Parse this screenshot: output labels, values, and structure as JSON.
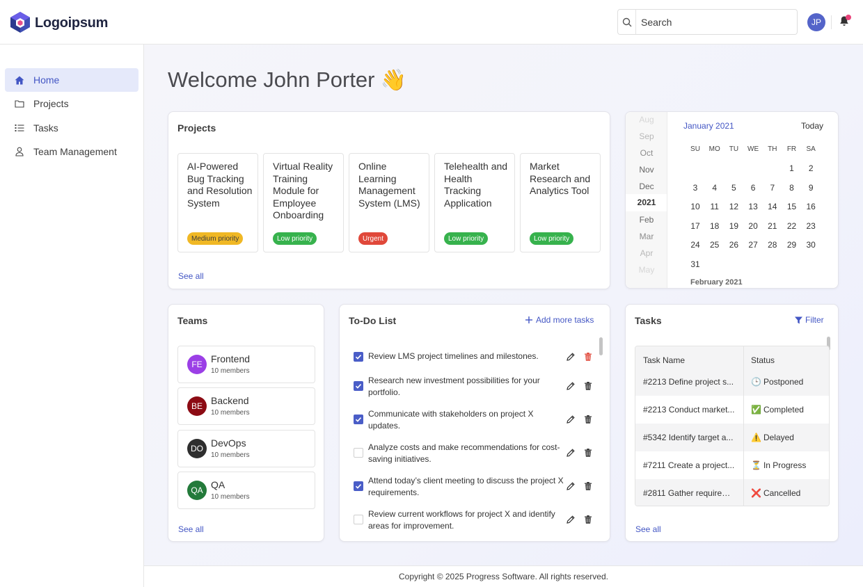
{
  "brand": {
    "name": "Logoipsum",
    "icon": "hexagon-logo-icon"
  },
  "search": {
    "placeholder": "Search"
  },
  "user": {
    "initials": "JP",
    "avatar_color": "#5464c9"
  },
  "sidebar": {
    "items": [
      {
        "label": "Home",
        "icon": "home-icon",
        "active": true
      },
      {
        "label": "Projects",
        "icon": "folder-icon",
        "active": false
      },
      {
        "label": "Tasks",
        "icon": "list-icon",
        "active": false
      },
      {
        "label": "Team Management",
        "icon": "person-icon",
        "active": false
      }
    ]
  },
  "welcome": {
    "text": "Welcome John Porter",
    "emoji": "👋"
  },
  "projects": {
    "title": "Projects",
    "see_all": "See all",
    "items": [
      {
        "name": "AI-Powered Bug Tracking and Resolution System",
        "priority": "Medium priority",
        "color": "#f0b825",
        "text_color": "#3d3d3d"
      },
      {
        "name": "Virtual Reality Training Module for Employee Onboarding",
        "priority": "Low priority",
        "color": "#37b24d",
        "text_color": "#ffffff"
      },
      {
        "name": "Online Learning Management System (LMS)",
        "priority": "Urgent",
        "color": "#e0483a",
        "text_color": "#ffffff"
      },
      {
        "name": "Telehealth and Health Tracking Application",
        "priority": "Low priority",
        "color": "#37b24d",
        "text_color": "#ffffff"
      },
      {
        "name": "Market Research and Analytics Tool",
        "priority": "Low priority",
        "color": "#37b24d",
        "text_color": "#ffffff"
      }
    ]
  },
  "calendar": {
    "header": "January 2021",
    "today": "Today",
    "months": [
      "Aug",
      "Sep",
      "Oct",
      "Nov",
      "Dec",
      "2021",
      "Feb",
      "Mar",
      "Apr",
      "May"
    ],
    "days_of_week": [
      "SU",
      "MO",
      "TU",
      "WE",
      "TH",
      "FR",
      "SA"
    ],
    "weeks": [
      [
        "",
        "",
        "",
        "",
        "",
        "1",
        "2"
      ],
      [
        "3",
        "4",
        "5",
        "6",
        "7",
        "8",
        "9"
      ],
      [
        "10",
        "11",
        "12",
        "13",
        "14",
        "15",
        "16"
      ],
      [
        "17",
        "18",
        "19",
        "20",
        "21",
        "22",
        "23"
      ],
      [
        "24",
        "25",
        "26",
        "27",
        "28",
        "29",
        "30"
      ],
      [
        "31",
        "",
        "",
        "",
        "",
        "",
        ""
      ]
    ],
    "next_month": "February 2021"
  },
  "teams": {
    "title": "Teams",
    "see_all": "See all",
    "items": [
      {
        "initials": "FE",
        "name": "Frontend",
        "members": "10 members",
        "color": "#9b3fe6"
      },
      {
        "initials": "BE",
        "name": "Backend",
        "members": "10 members",
        "color": "#8c0b14"
      },
      {
        "initials": "DO",
        "name": "DevOps",
        "members": "10 members",
        "color": "#2e2e2e"
      },
      {
        "initials": "QA",
        "name": "QA",
        "members": "10 members",
        "color": "#237a3a"
      }
    ]
  },
  "todo": {
    "title": "To-Do List",
    "add_label": "Add more tasks",
    "items": [
      {
        "text": "Review LMS project timelines and milestones.",
        "checked": true
      },
      {
        "text": "Research new investment possibilities for your portfolio.",
        "checked": true
      },
      {
        "text": "Communicate with stakeholders on project X updates.",
        "checked": true
      },
      {
        "text": "Analyze costs and make recommendations for cost-saving initiatives.",
        "checked": false
      },
      {
        "text": "Attend today’s client meeting to discuss the project X requirements.",
        "checked": true
      },
      {
        "text": "Review current workflows for project X and identify areas for improvement.",
        "checked": false
      }
    ]
  },
  "tasks": {
    "title": "Tasks",
    "filter_label": "Filter",
    "see_all": "See all",
    "columns": [
      "Task Name",
      "Status"
    ],
    "rows": [
      {
        "name": "#2213 Define project s...",
        "status": "Postponed",
        "icon": "🕒"
      },
      {
        "name": "#2213 Conduct market...",
        "status": "Completed",
        "icon": "✅"
      },
      {
        "name": "#5342 Identify target a...",
        "status": "Delayed",
        "icon": "⚠️"
      },
      {
        "name": "#7211 Create a project...",
        "status": "In Progress",
        "icon": "⏳"
      },
      {
        "name": "#2811 Gather requirem...",
        "status": "Cancelled",
        "icon": "❌"
      }
    ]
  },
  "footer": {
    "text": "Copyright © 2025 Progress Software. All rights reserved."
  },
  "colors": {
    "accent": "#4356c4",
    "active_nav_bg": "#e5e9fa"
  }
}
